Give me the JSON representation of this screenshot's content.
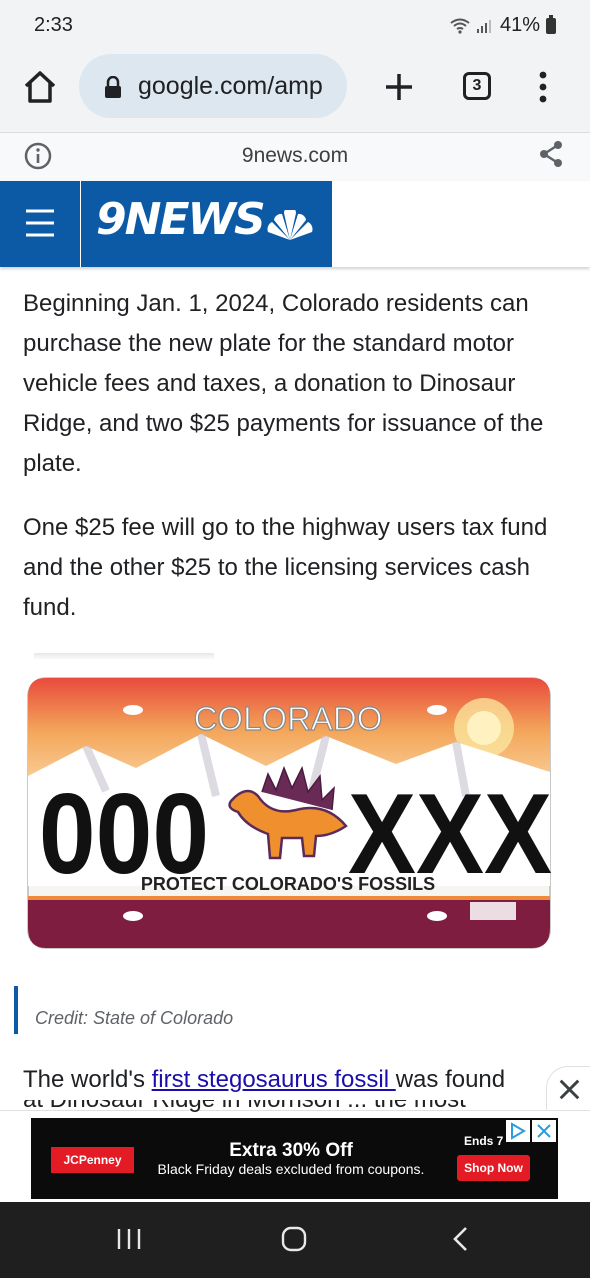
{
  "status_bar": {
    "time": "2:33",
    "battery": "41%"
  },
  "browser": {
    "url": "google.com/amp",
    "tab_count": "3",
    "amp_domain": "9news.com"
  },
  "site": {
    "logo": "9NEWS"
  },
  "article": {
    "paragraph1": "Beginning Jan. 1, 2024, Colorado residents can purchase the new plate for the standard motor vehicle fees and taxes, a donation to Dinosaur Ridge, and two $25 payments for issuance of the plate.",
    "paragraph2": "One $25 fee will go to the highway users tax fund and the other $25 to the licensing services cash fund.",
    "plate": {
      "state": "COLORADO",
      "left_chars": "000",
      "right_chars": "XXX",
      "slogan": "PROTECT COLORADO'S FOSSILS"
    },
    "credit": "Credit: State of Colorado",
    "paragraph3_before": "The world's ",
    "paragraph3_link": "first stegosaurus fossil ",
    "paragraph3_after": "was found",
    "paragraph3_cut": "at Dinosaur Ridge in Morrison ... the most"
  },
  "ad": {
    "brand": "JCPenney",
    "title": "Extra 30% Off",
    "subtitle": "Black Friday deals excluded from coupons.",
    "ends": "Ends 7",
    "cta": "Shop Now",
    "brand_color": "#e21b24"
  },
  "colors": {
    "accent": "#0c5aa6",
    "link": "#1a0dab"
  }
}
